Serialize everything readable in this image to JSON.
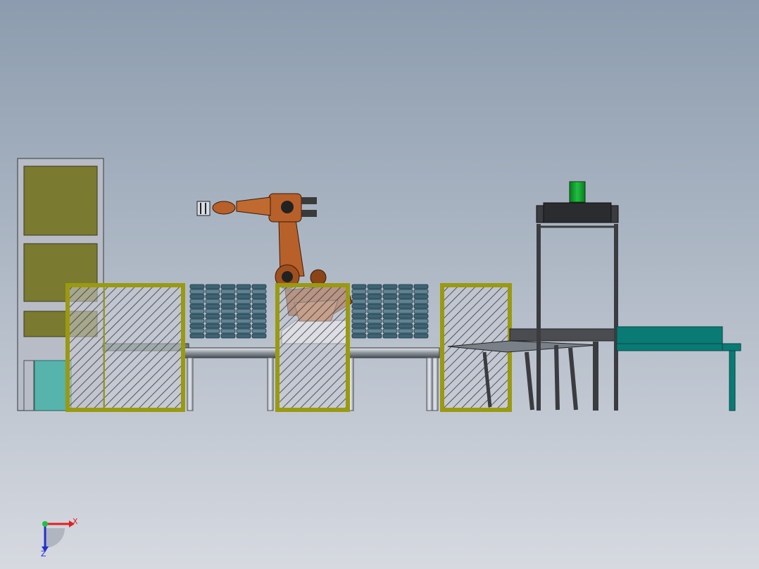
{
  "triad": {
    "x_label": "X",
    "z_label": "Z",
    "x_color": "#e02020",
    "z_color": "#2030d0",
    "origin_color": "#20c040"
  },
  "colors": {
    "bg_top": "#8c9cae",
    "bg_bottom": "#d4d7df",
    "fence_frame": "#9a9a10",
    "cabinet_panel": "#7a7a30",
    "cabinet_frame": "#9aa0ac",
    "robot": "#b8602a",
    "pallet_stack": "#4a7080",
    "conveyor_teal": "#0a7a74",
    "stand_dark": "#3a3c40",
    "bucket_green": "#10a030"
  }
}
